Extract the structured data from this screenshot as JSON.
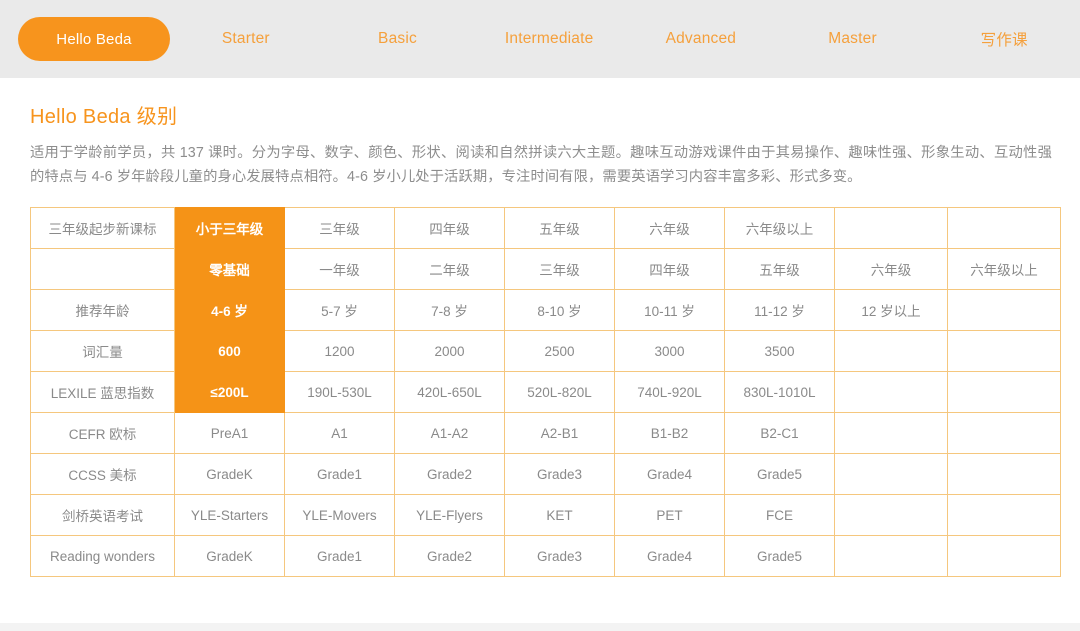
{
  "nav": {
    "active_pill": "Hello Beda",
    "items": [
      {
        "label": "Starter"
      },
      {
        "label": "Basic"
      },
      {
        "label": "Intermediate"
      },
      {
        "label": "Advanced"
      },
      {
        "label": "Master"
      },
      {
        "label": "写作课"
      }
    ]
  },
  "section": {
    "title": "Hello Beda 级别",
    "description": "适用于学龄前学员，共 137 课时。分为字母、数字、颜色、形状、阅读和自然拼读六大主题。趣味互动游戏课件由于其易操作、趣味性强、形象生动、互动性强的特点与 4-6 岁年龄段儿童的身心发展特点相符。4-6 岁小儿处于活跃期，专注时间有限，需要英语学习内容丰富多彩、形式多变。"
  },
  "table": {
    "highlight_column_index": 1,
    "highlight_row_count": 5,
    "rows": [
      {
        "cells": [
          "三年级起步新课标",
          "小于三年级",
          "三年级",
          "四年级",
          "五年级",
          "六年级",
          "六年级以上",
          "",
          ""
        ]
      },
      {
        "cells": [
          "",
          "零基础",
          "一年级",
          "二年级",
          "三年级",
          "四年级",
          "五年级",
          "六年级",
          "六年级以上"
        ]
      },
      {
        "cells": [
          "推荐年龄",
          "4-6 岁",
          "5-7 岁",
          "7-8 岁",
          "8-10 岁",
          "10-11 岁",
          "11-12 岁",
          "12 岁以上",
          ""
        ]
      },
      {
        "cells": [
          "词汇量",
          "600",
          "1200",
          "2000",
          "2500",
          "3000",
          "3500",
          "",
          ""
        ]
      },
      {
        "cells": [
          "LEXILE 蓝思指数",
          "≤200L",
          "190L-530L",
          "420L-650L",
          "520L-820L",
          "740L-920L",
          "830L-1010L",
          "",
          ""
        ]
      },
      {
        "cells": [
          "CEFR 欧标",
          "PreA1",
          "A1",
          "A1-A2",
          "A2-B1",
          "B1-B2",
          "B2-C1",
          "",
          ""
        ]
      },
      {
        "cells": [
          "CCSS 美标",
          "GradeK",
          "Grade1",
          "Grade2",
          "Grade3",
          "Grade4",
          "Grade5",
          "",
          ""
        ]
      },
      {
        "cells": [
          "剑桥英语考试",
          "YLE-Starters",
          "YLE-Movers",
          "YLE-Flyers",
          "KET",
          "PET",
          "FCE",
          "",
          ""
        ]
      },
      {
        "cells": [
          "Reading wonders",
          "GradeK",
          "Grade1",
          "Grade2",
          "Grade3",
          "Grade4",
          "Grade5",
          "",
          ""
        ]
      }
    ]
  },
  "colors": {
    "accent": "#f7941d",
    "highlight_cell": "#f59317",
    "nav_text": "#f5a03c",
    "table_border": "#f5c77e",
    "body_text": "#8a8a8a",
    "navbar_bg": "#eaeaea"
  }
}
